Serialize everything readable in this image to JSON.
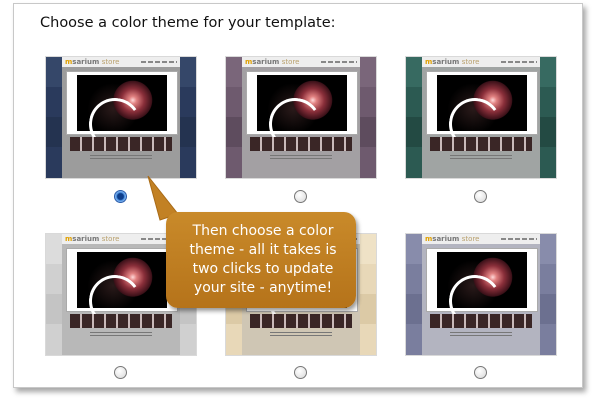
{
  "heading": "Choose a color theme for your template:",
  "callout": {
    "text": "Then choose a color theme - all it takes is two clicks to update your site - anytime!",
    "color": "#bf7d22"
  },
  "preview": {
    "logo_main": "sarium",
    "logo_m": "m",
    "logo_sub": "store"
  },
  "themes": [
    {
      "name": "navy",
      "color": "#2a3a5c",
      "selected": true
    },
    {
      "name": "plum",
      "color": "#6e5a6e",
      "selected": false
    },
    {
      "name": "teal",
      "color": "#2c5a52",
      "selected": false
    },
    {
      "name": "silver",
      "color": "#d0d0d0",
      "selected": false
    },
    {
      "name": "sand",
      "color": "#e8d8b8",
      "selected": false
    },
    {
      "name": "slate-blue",
      "color": "#7a7e9e",
      "selected": false
    }
  ]
}
